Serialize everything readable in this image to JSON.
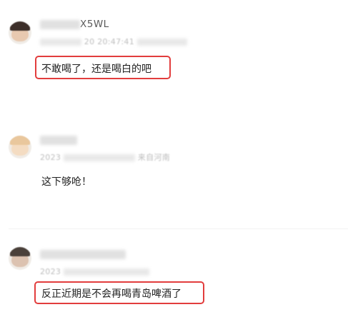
{
  "comments": [
    {
      "username_visible": "X5WL",
      "meta_visible": "20 20:47:41",
      "text": "不敢喝了，还是喝白的吧",
      "highlighted": true,
      "avatar_colors": {
        "hair": "#3d2f2a",
        "skin": "#e8c9b0"
      }
    },
    {
      "username_visible": "",
      "meta_visible": "2023",
      "location_visible": "来自河南",
      "text": "这下够呛！",
      "highlighted": false,
      "avatar_colors": {
        "hair": "#e9c79d",
        "skin": "#f4dcc2"
      }
    },
    {
      "username_visible": "",
      "meta_visible": "2023",
      "text": "反正近期是不会再喝青岛啤酒了",
      "highlighted": true,
      "avatar_colors": {
        "hair": "#4a403a",
        "skin": "#dcc2b0"
      }
    }
  ],
  "colors": {
    "highlight_border": "#e23d3d",
    "text": "#222222",
    "meta": "#bcbcbc"
  }
}
